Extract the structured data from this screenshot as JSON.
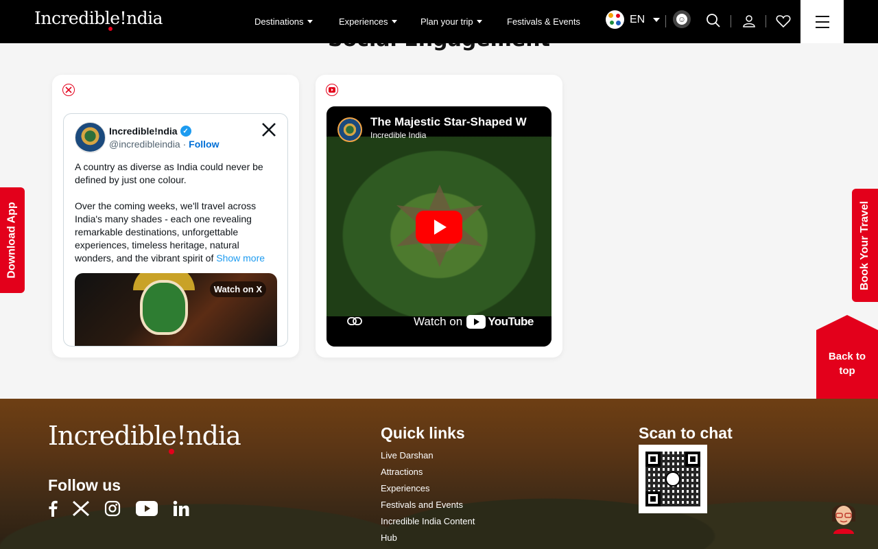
{
  "header": {
    "logo_text": "Incredible!ndia",
    "nav": [
      {
        "label": "Destinations",
        "has_dropdown": true
      },
      {
        "label": "Experiences",
        "has_dropdown": true
      },
      {
        "label": "Plan your trip",
        "has_dropdown": true
      },
      {
        "label": "Festivals & Events",
        "has_dropdown": false
      }
    ],
    "language": "EN"
  },
  "section": {
    "title": "Social Engagement"
  },
  "tweet": {
    "name": "Incredible!ndia",
    "handle": "@incredibleindia",
    "separator": "·",
    "follow_label": "Follow",
    "text": "A country as diverse as India could never be defined by just one colour.\n\nOver the coming weeks, we'll travel across India's many shades - each one revealing remarkable destinations, unforgettable experiences, timeless heritage, natural wonders, and the vibrant spirit of ",
    "show_more": "Show more",
    "watch_label": "Watch on X"
  },
  "youtube": {
    "title": "The Majestic Star-Shaped W",
    "channel": "Incredible India",
    "watch_label": "Watch on",
    "logo_text": "YouTube"
  },
  "side": {
    "download_app": "Download App",
    "book_travel": "Book Your Travel",
    "back_to_top": "Back to top"
  },
  "footer": {
    "logo_text": "Incredible!ndia",
    "follow_us": "Follow us",
    "socials": [
      "facebook-icon",
      "x-icon",
      "instagram-icon",
      "youtube-icon",
      "linkedin-icon"
    ],
    "quick_links_title": "Quick links",
    "quick_links": [
      "Live Darshan",
      "Attractions",
      "Experiences",
      "Festivals and Events",
      "Incredible India Content Hub"
    ],
    "scan_title": "Scan to chat"
  },
  "colors": {
    "accent": "#e3001b",
    "header_bg": "#000000",
    "link": "#006fd6"
  }
}
